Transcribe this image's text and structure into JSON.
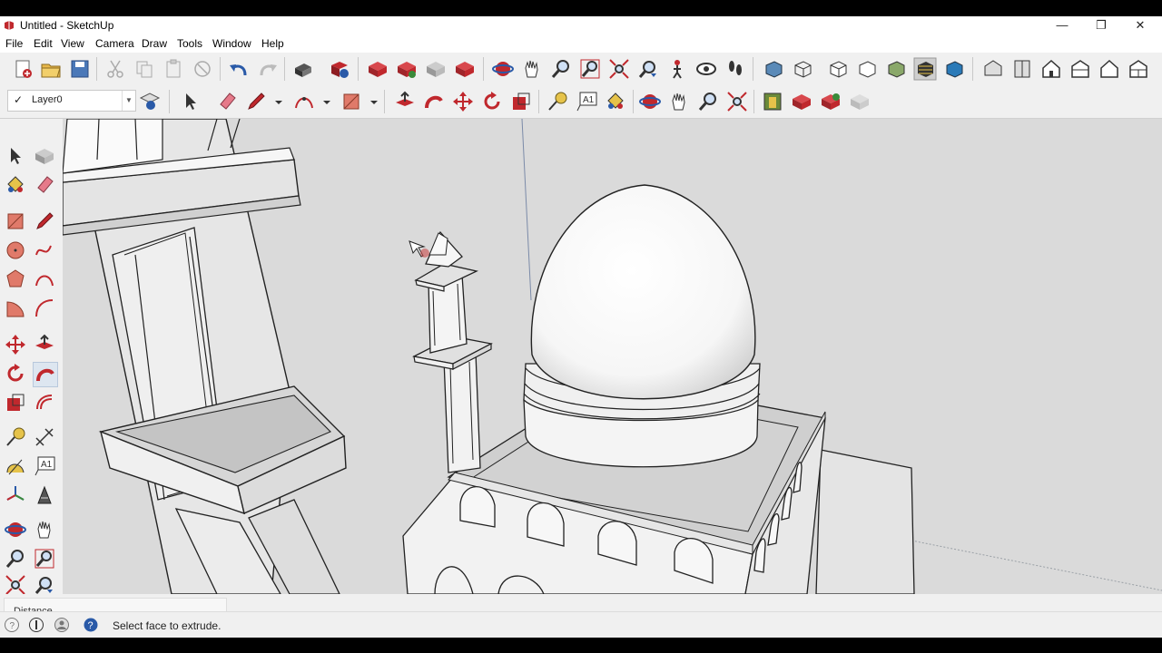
{
  "window": {
    "title": "Untitled - SketchUp",
    "minimize_glyph": "—",
    "restore_glyph": "❐",
    "close_glyph": "✕"
  },
  "menu": [
    "File",
    "Edit",
    "View",
    "Camera",
    "Draw",
    "Tools",
    "Window",
    "Help"
  ],
  "layers": {
    "check_glyph": "✓",
    "current_layer": "Layer0",
    "dropdown_glyph": "▼"
  },
  "measurements": {
    "label": "Distance",
    "value": ""
  },
  "status": {
    "hint": "Select face to extrude."
  },
  "toolbar_icons_row1": [
    "new-file-icon",
    "open-file-icon",
    "save-icon",
    "cut-icon",
    "copy-icon",
    "paste-icon",
    "erase-icon",
    "undo-icon",
    "redo-icon",
    "print-icon",
    "model-info-icon",
    "component-icon",
    "component-icon",
    "component-icon",
    "component-icon",
    "orbit-icon",
    "pan-icon",
    "zoom-icon",
    "zoom-window-icon",
    "zoom-extents-icon",
    "previous-view-icon",
    "position-camera-icon",
    "look-around-icon",
    "walk-icon",
    "xray-style-icon",
    "wireframe-style-icon",
    "hidden-line-style-icon",
    "hidden-line-style-icon",
    "shaded-style-icon",
    "shaded-textures-style-icon",
    "monochrome-style-icon",
    "iso-view-icon",
    "top-view-icon",
    "front-view-icon",
    "right-view-icon",
    "back-view-icon",
    "left-view-icon"
  ],
  "toolbar_icons_row2": [
    "select-icon",
    "eraser-icon",
    "pencil-icon",
    "arc-icon",
    "rectangle-icon",
    "push-pull-icon",
    "follow-me-icon",
    "move-icon",
    "rotate-icon",
    "scale-icon",
    "tape-measure-icon",
    "text-icon",
    "paint-bucket-icon",
    "orbit-icon",
    "pan-icon",
    "zoom-icon",
    "zoom-extents-icon",
    "warehouse-icon",
    "extension-icon",
    "extension-icon",
    "sketchup-icon"
  ],
  "left_tools": [
    "select-icon",
    "component-icon",
    "paint-bucket-icon",
    "eraser-icon",
    "rectangle-icon",
    "pencil-icon",
    "circle-icon",
    "freehand-icon",
    "polygon-icon",
    "arc-icon",
    "pie-icon",
    "two-point-arc-icon",
    "move-icon",
    "push-pull-icon",
    "rotate-icon",
    "follow-me-icon",
    "scale-icon",
    "offset-icon",
    "tape-measure-icon",
    "dimension-icon",
    "protractor-icon",
    "text-icon",
    "axes-icon",
    "3d-text-icon",
    "orbit-icon",
    "pan-icon",
    "zoom-icon",
    "zoom-window-icon",
    "zoom-extents-icon",
    "previous-icon"
  ],
  "colors": {
    "accent_red": "#c0282d",
    "viewport_bg": "#dcdcdc",
    "chrome_bg": "#f0f0f0"
  }
}
